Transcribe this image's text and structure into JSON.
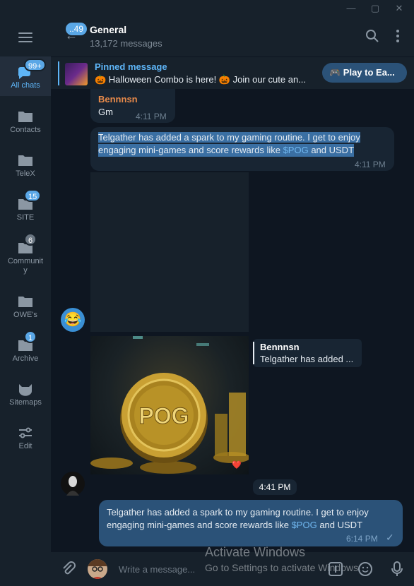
{
  "window": {
    "minimize_icon": "minimize-icon",
    "maximize_icon": "maximize-icon",
    "close_icon": "close-icon"
  },
  "sidebar": {
    "menu_icon": "hamburger-menu-icon",
    "items": [
      {
        "label": "All chats",
        "badge": "99+",
        "icon": "chat-bubbles-icon",
        "active": true
      },
      {
        "label": "Contacts",
        "badge": "",
        "icon": "folder-icon"
      },
      {
        "label": "TeleX",
        "badge": "",
        "icon": "folder-icon"
      },
      {
        "label": "SITE",
        "badge": "15",
        "icon": "folder-icon"
      },
      {
        "label": "Communit",
        "label2": "y",
        "badge": "6",
        "icon": "folder-icon"
      },
      {
        "label": "OWE's",
        "badge": "",
        "icon": "folder-icon"
      },
      {
        "label": "Archive",
        "badge": "1",
        "icon": "folder-icon"
      },
      {
        "label": "Sitemaps",
        "badge": "",
        "icon": "cat-icon"
      },
      {
        "label": "Edit",
        "badge": "",
        "icon": "sliders-icon"
      }
    ]
  },
  "header": {
    "back_badge": "..49",
    "title": "General",
    "subtitle": "13,172 messages"
  },
  "pinned": {
    "title": "Pinned message",
    "text": "🎃 Halloween Combo is here! 🎃 Join our cute an...",
    "button": "🎮 Play to Ea..."
  },
  "messages": {
    "m1": {
      "sender": "Bennnsn",
      "text": "Gm",
      "time": "4:11 PM"
    },
    "m2": {
      "line1_hl": "T",
      "line1_rest": "elgather has added a spark to my gaming routine. I get to enjoy",
      "line2_pre": "engaging mini-games and score rewards like ",
      "line2_link": "$POG",
      "line2_post": " and USDT",
      "time": "4:11 PM"
    },
    "image": {
      "coin_text": "POG",
      "reaction": "❤️",
      "time": "4:41 PM"
    },
    "reply": {
      "name": "Bennnsn",
      "text": "Telgather has added ..."
    },
    "m3": {
      "line1": "Telgather has added a spark to my gaming routine. I get to enjoy",
      "line2_pre": "engaging mini-games and score rewards like ",
      "line2_link": "$POG",
      "line2_post": " and USDT",
      "time": "6:14 PM",
      "check": "✓"
    }
  },
  "composer": {
    "placeholder": "Write a message...",
    "watermark_title": "Activate Windows",
    "watermark_sub": "Go to Settings to activate Windows."
  },
  "colors": {
    "accent": "#5eb5f7",
    "sender": "#e88a4a",
    "bubble_out": "#2b5278",
    "bubble_in": "#182533"
  }
}
